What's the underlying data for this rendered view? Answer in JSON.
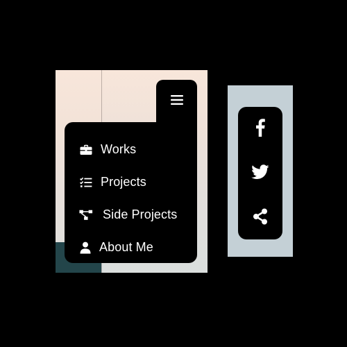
{
  "menu": {
    "toggle_icon": "hamburger-icon",
    "items": [
      {
        "label": "Works",
        "icon": "briefcase-icon"
      },
      {
        "label": "Projects",
        "icon": "checklist-icon"
      },
      {
        "label": "Side Projects",
        "icon": "sitemap-icon"
      },
      {
        "label": "About Me",
        "icon": "user-icon"
      }
    ]
  },
  "social": {
    "buttons": [
      {
        "icon": "facebook-icon"
      },
      {
        "icon": "twitter-icon"
      },
      {
        "icon": "share-icon"
      }
    ]
  },
  "colors": {
    "background": "#000000",
    "menu_bg": "#000000",
    "menu_text": "#ffffff",
    "panel_left_top": "#f8e6da",
    "panel_left_accent": "#23454a",
    "panel_right": "#c4d0d6"
  }
}
